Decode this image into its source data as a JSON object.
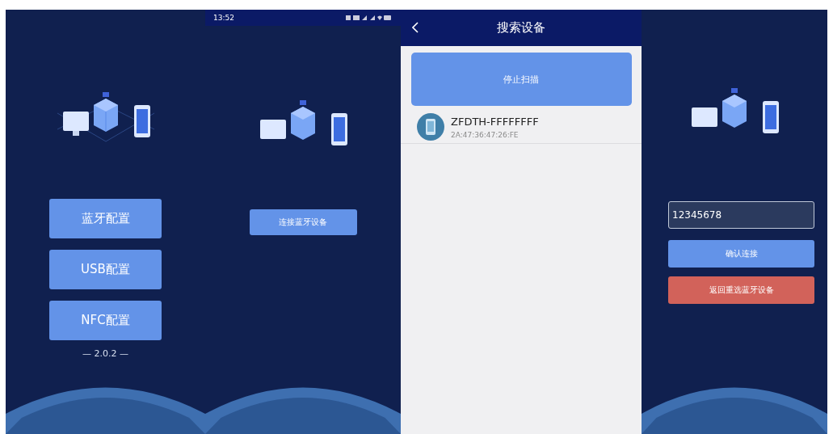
{
  "screens": [
    {
      "kind": "menu",
      "buttons": [
        "蓝牙配置",
        "USB配置",
        "NFC配置"
      ],
      "version": "— 2.0.2 —"
    },
    {
      "kind": "connect",
      "status_bar": {
        "time": "13:52"
      },
      "button": "连接蓝牙设备"
    },
    {
      "kind": "search",
      "title": "搜索设备",
      "scan_button": "停止扫描",
      "devices": [
        {
          "name": "ZFDTH-FFFFFFFF",
          "address": "2A:47:36:47:26:FE"
        }
      ]
    },
    {
      "kind": "password",
      "input": {
        "value": "12345678"
      },
      "buttons": [
        {
          "label": "确认连接",
          "kind": "primary"
        },
        {
          "label": "返回重选蓝牙设备",
          "kind": "danger"
        }
      ]
    }
  ]
}
